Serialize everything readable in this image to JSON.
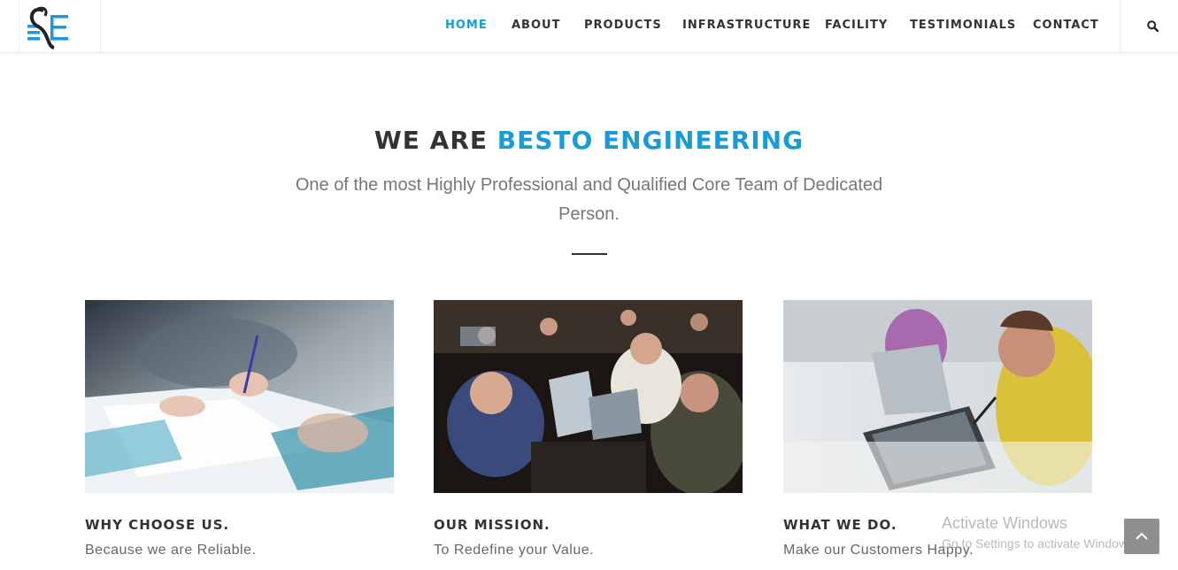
{
  "brand": {
    "logo_letters": "BE"
  },
  "nav": {
    "items": [
      {
        "label": "HOME"
      },
      {
        "label": "ABOUT"
      },
      {
        "label": "PRODUCTS"
      },
      {
        "label": "INFRASTRUCTURE"
      },
      {
        "label": "FACILITY"
      },
      {
        "label": "TESTIMONIALS"
      },
      {
        "label": "CONTACT"
      }
    ],
    "active": "HOME",
    "search_icon": "search-icon"
  },
  "intro": {
    "title_prefix": "WE ARE ",
    "title_accent": "BESTO ENGINEERING",
    "subtitle": "One of the most Highly Professional and Qualified Core Team of Dedicated Person."
  },
  "cards": [
    {
      "title": "WHY CHOOSE US.",
      "text": "Because we are Reliable."
    },
    {
      "title": "OUR MISSION.",
      "text": "To Redefine your Value."
    },
    {
      "title": "WHAT WE DO.",
      "text": "Make our Customers Happy."
    }
  ],
  "watermark": {
    "line1": "Activate Windows",
    "line2": "Go to Settings to activate Windows."
  },
  "colors": {
    "accent": "#1a9bd7",
    "text": "#333333",
    "muted": "#777777"
  }
}
